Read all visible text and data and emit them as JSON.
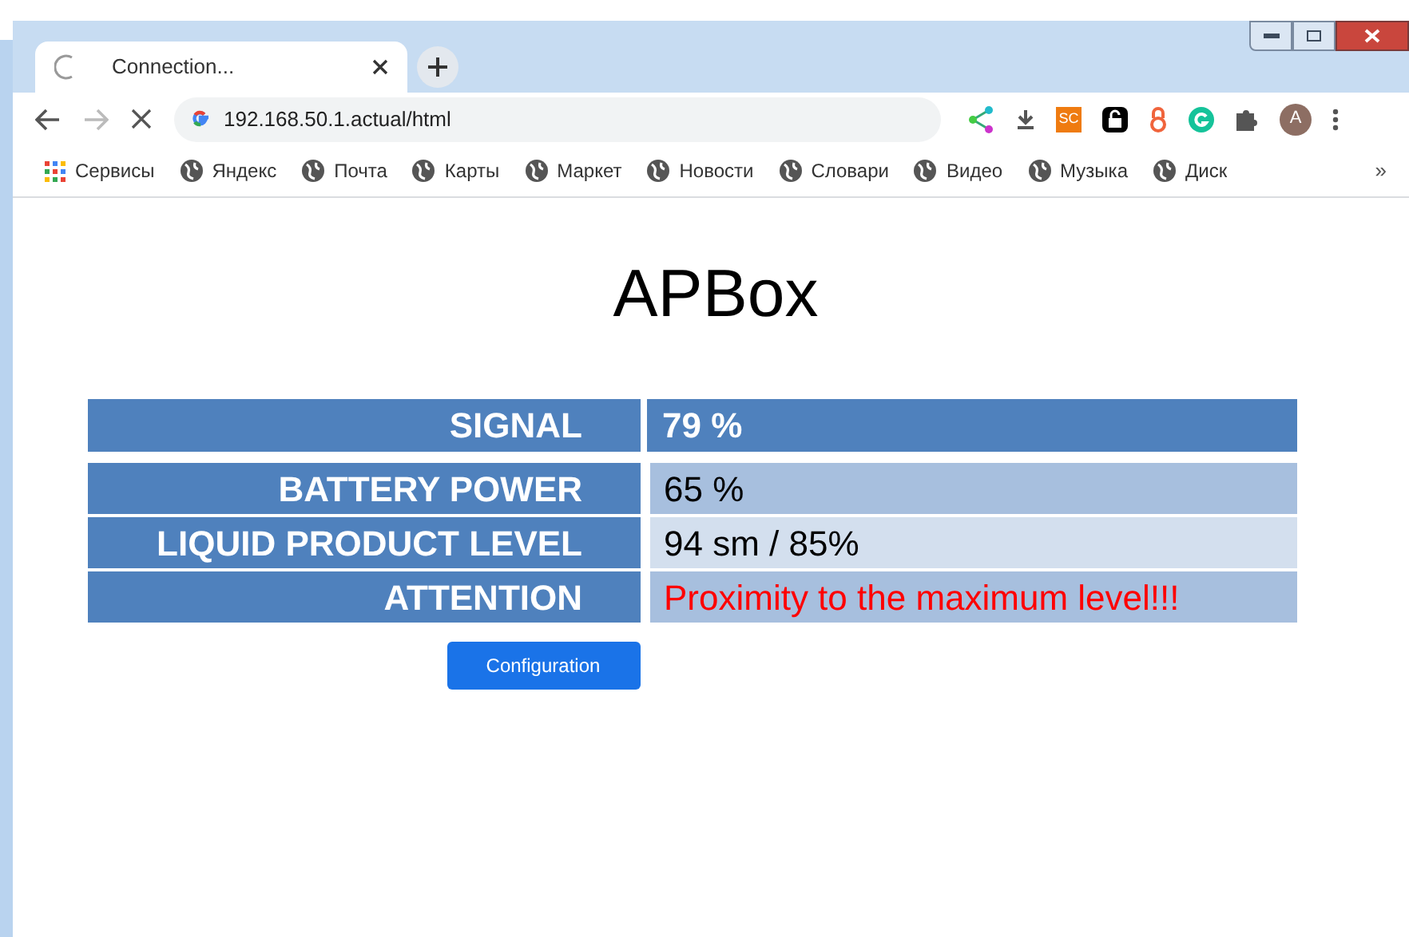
{
  "browser": {
    "tab_title": "Connection...",
    "address": "192.168.50.1.actual/html",
    "bookmarks": [
      {
        "label": "Сервисы",
        "kind": "apps"
      },
      {
        "label": "Яндекс",
        "kind": "site"
      },
      {
        "label": "Почта",
        "kind": "site"
      },
      {
        "label": "Карты",
        "kind": "site"
      },
      {
        "label": "Маркет",
        "kind": "site"
      },
      {
        "label": "Новости",
        "kind": "site"
      },
      {
        "label": "Словари",
        "kind": "site"
      },
      {
        "label": "Видео",
        "kind": "site"
      },
      {
        "label": "Музыка",
        "kind": "site"
      },
      {
        "label": "Диск",
        "kind": "site"
      }
    ],
    "extension_sc": "SC",
    "avatar": "A",
    "more_bookmarks": "»"
  },
  "page": {
    "title": "APBox",
    "rows": [
      {
        "label": "SIGNAL",
        "value": "79 %",
        "kind": "header"
      },
      {
        "label": "BATTERY POWER",
        "value": "65 %",
        "kind": "data"
      },
      {
        "label": "LIQUID PRODUCT LEVEL",
        "value": "94 sm / 85%",
        "kind": "data"
      },
      {
        "label": "ATTENTION",
        "value": "Proximity to the maximum level!!!",
        "kind": "alert"
      }
    ],
    "button": "Configuration"
  }
}
